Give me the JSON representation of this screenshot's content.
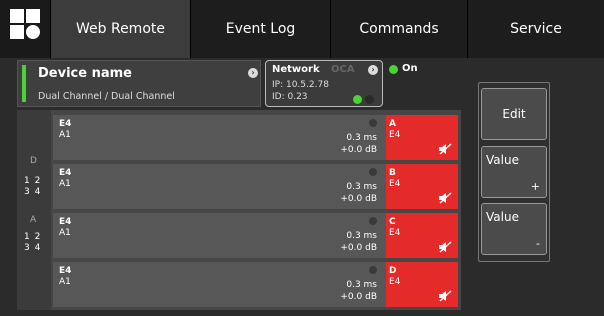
{
  "tabs": [
    {
      "label": "Web Remote",
      "active": true
    },
    {
      "label": "Event Log",
      "active": false
    },
    {
      "label": "Commands",
      "active": false
    },
    {
      "label": "Service",
      "active": false
    }
  ],
  "device": {
    "name": "Device name",
    "subtitle": "Dual Channel / Dual Channel"
  },
  "network": {
    "title": "Network",
    "oca": "OCA",
    "ip": "IP: 10.5.2.78",
    "id": "ID:  0.23"
  },
  "power": {
    "label": "On",
    "color": "#4cd137"
  },
  "side": {
    "group_d": "D",
    "group_a": "A",
    "num_row1": "1 2",
    "num_row2": "3 4"
  },
  "channels": [
    {
      "line1": "E4",
      "line2": "A1",
      "delay": "0.3 ms",
      "gain": "+0.0 dB",
      "out": "A",
      "out_sub": "E4"
    },
    {
      "line1": "E4",
      "line2": "A1",
      "delay": "0.3 ms",
      "gain": "+0.0 dB",
      "out": "B",
      "out_sub": "E4"
    },
    {
      "line1": "E4",
      "line2": "A1",
      "delay": "0.3 ms",
      "gain": "+0.0 dB",
      "out": "C",
      "out_sub": "E4"
    },
    {
      "line1": "E4",
      "line2": "A1",
      "delay": "0.3 ms",
      "gain": "+0.0 dB",
      "out": "D",
      "out_sub": "E4"
    }
  ],
  "controls": {
    "edit": "Edit",
    "value_up": "Value",
    "value_up_sym": "+",
    "value_down": "Value",
    "value_down_sym": "-"
  },
  "colors": {
    "mute_red": "#e52a2a",
    "status_green": "#4cd137"
  }
}
